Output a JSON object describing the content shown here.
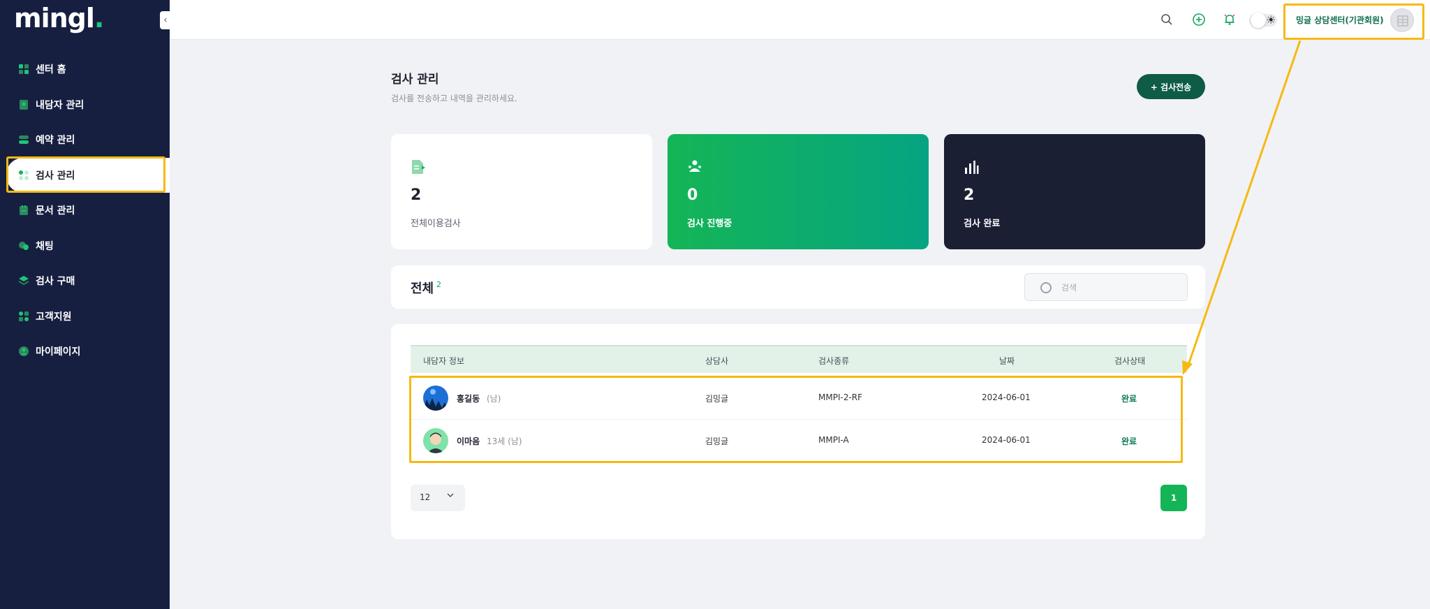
{
  "brand": {
    "logo_text": "mingl",
    "logo_dot": "."
  },
  "sidebar": {
    "items": [
      {
        "label": "센터 홈",
        "icon": "home-grid-icon"
      },
      {
        "label": "내담자 관리",
        "icon": "client-icon"
      },
      {
        "label": "예약 관리",
        "icon": "reservation-toggle-icon"
      },
      {
        "label": "검사 관리",
        "icon": "test-grid-icon",
        "active": true
      },
      {
        "label": "문서 관리",
        "icon": "document-icon"
      },
      {
        "label": "채팅",
        "icon": "chat-icon"
      },
      {
        "label": "검사 구매",
        "icon": "purchase-stack-icon"
      },
      {
        "label": "고객지원",
        "icon": "support-icon"
      },
      {
        "label": "마이페이지",
        "icon": "user-icon"
      }
    ]
  },
  "topbar": {
    "user_name": "밍글 상담센터(기관회원)",
    "icons": [
      "search-icon",
      "add-circle-icon",
      "bell-icon",
      "theme-toggle",
      "avatar"
    ]
  },
  "page": {
    "title": "검사 관리",
    "subtitle": "검사를 전송하고 내역을 관리하세요.",
    "send_button": "+ 검사전송"
  },
  "stats": [
    {
      "value": "2",
      "label": "전체이용검사"
    },
    {
      "value": "0",
      "label": "검사 진행중"
    },
    {
      "value": "2",
      "label": "검사 완료"
    }
  ],
  "filter": {
    "title": "전체",
    "count": "2",
    "search_placeholder": "검색"
  },
  "table": {
    "columns": [
      "내담자 정보",
      "상담사",
      "검사종류",
      "날짜",
      "검사상태"
    ],
    "rows": [
      {
        "name": "홍길동",
        "meta": "(남)",
        "counselor": "김밍글",
        "test": "MMPI-2-RF",
        "date": "2024-06-01",
        "status": "완료"
      },
      {
        "name": "이마음",
        "meta": "13세 (남)",
        "counselor": "김밍글",
        "test": "MMPI-A",
        "date": "2024-06-01",
        "status": "완료"
      }
    ]
  },
  "pagination": {
    "page_size": "12",
    "current_page": "1"
  },
  "colors": {
    "sidebar_bg": "#171f41",
    "brand_green": "#14b556",
    "dark_green": "#0e5c46",
    "highlight": "#f6b913"
  }
}
